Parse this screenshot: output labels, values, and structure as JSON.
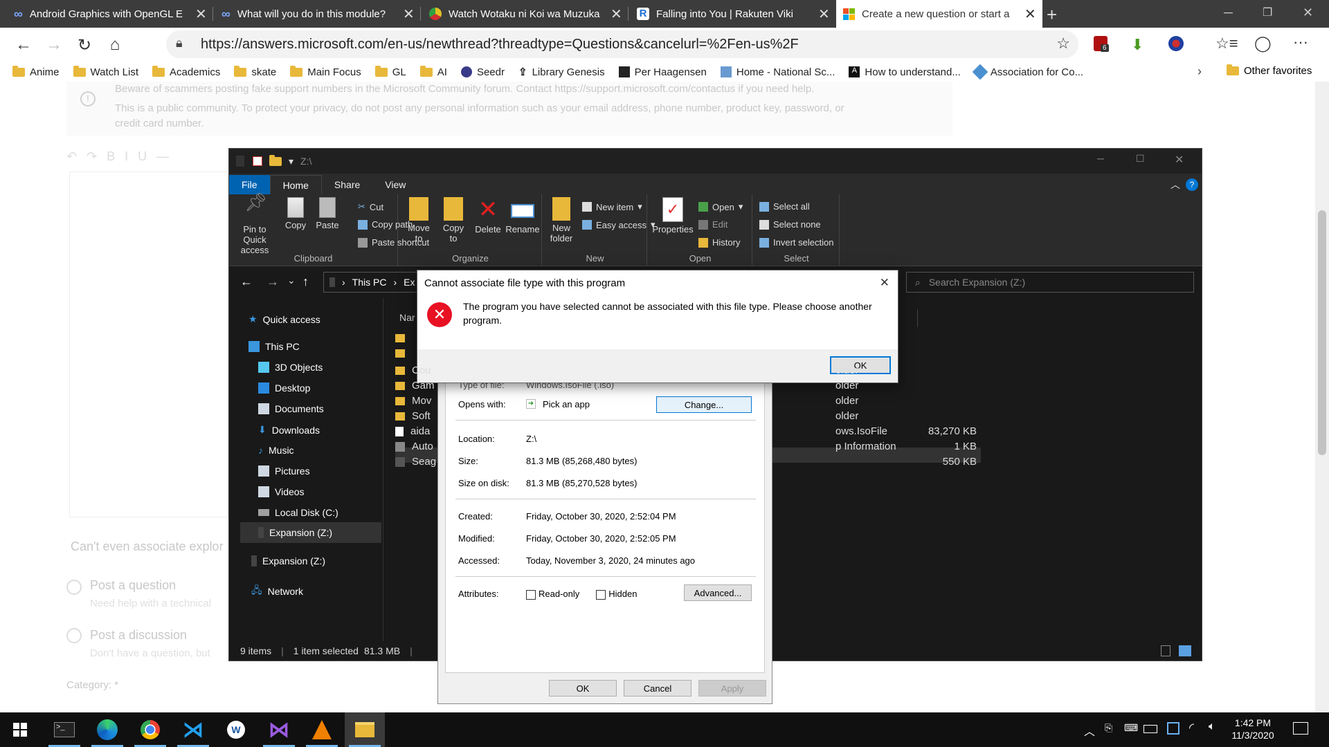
{
  "browser": {
    "tabs": [
      {
        "title": "Android Graphics with OpenGL E",
        "icon": "coursera-infinity-icon",
        "color": "#4a7bd6"
      },
      {
        "title": "What will you do in this module?",
        "icon": "coursera-infinity-icon",
        "color": "#4a7bd6"
      },
      {
        "title": "Watch Wotaku ni Koi wa Muzuka",
        "icon": "anime-site-icon",
        "color": "#e0c020"
      },
      {
        "title": "Falling into You | Rakuten Viki",
        "icon": "viki-icon",
        "color": "#1a6fd6"
      },
      {
        "title": "Create a new question or start a",
        "icon": "microsoft-logo-icon",
        "color": "#f25022"
      }
    ],
    "new_tab": "+",
    "url": "https://answers.microsoft.com/en-us/newthread?threadtype=Questions&cancelurl=%2Fen-us%2F",
    "extension_badge": "6",
    "favorites": [
      "Anime",
      "Watch List",
      "Academics",
      "skate",
      "Main Focus",
      "GL",
      "AI",
      "Seedr",
      "Library Genesis",
      "Per Haagensen",
      "Home - National Sc...",
      "How to understand...",
      "Association for Co..."
    ],
    "other_favorites": "Other favorites"
  },
  "page": {
    "warning_line1": "Beware of scammers posting fake support numbers in the Microsoft Community forum. Contact https://support.microsoft.com/contactus if you need help.",
    "warning_line2": "This is a public community. To protect your privacy, do not post any personal information such as your email address, phone number, product key, password, or",
    "warning_line3": "credit card number.",
    "body_text": "Can't even associate explor",
    "option1_title": "Post a question",
    "option1_sub": "Need help with a technical",
    "option2_title": "Post a discussion",
    "option2_sub": "Don't have a question, but",
    "category_label": "Category: *"
  },
  "explorer": {
    "title": "Z:\\",
    "ribbon_tabs": [
      "File",
      "Home",
      "Share",
      "View"
    ],
    "clipboard": {
      "pin": "Pin to Quick access",
      "copy": "Copy",
      "paste": "Paste",
      "cut": "Cut",
      "copy_path": "Copy path",
      "paste_shortcut": "Paste shortcut",
      "label": "Clipboard"
    },
    "organize": {
      "move_to": "Move to",
      "copy_to": "Copy to",
      "delete": "Delete",
      "rename": "Rename",
      "label": "Organize"
    },
    "new": {
      "new_folder": "New folder",
      "new_item": "New item",
      "easy_access": "Easy access",
      "label": "New"
    },
    "open": {
      "properties": "Properties",
      "open": "Open",
      "edit": "Edit",
      "history": "History",
      "label": "Open"
    },
    "select": {
      "select_all": "Select all",
      "select_none": "Select none",
      "invert": "Invert selection",
      "label": "Select"
    },
    "breadcrumb": [
      "This PC",
      "Ex"
    ],
    "search_placeholder": "Search Expansion (Z:)",
    "nav": [
      {
        "label": "Quick access",
        "icon": "star-icon",
        "color": "#3a96dd"
      },
      {
        "label": "This PC",
        "icon": "pc-icon",
        "color": "#3a96dd"
      },
      {
        "label": "3D Objects",
        "icon": "cube-icon",
        "color": "#56c8f0"
      },
      {
        "label": "Desktop",
        "icon": "desktop-icon",
        "color": "#2a8adf"
      },
      {
        "label": "Documents",
        "icon": "document-icon",
        "color": "#cfd8e2"
      },
      {
        "label": "Downloads",
        "icon": "download-icon",
        "color": "#3a96dd"
      },
      {
        "label": "Music",
        "icon": "music-icon",
        "color": "#3a96dd"
      },
      {
        "label": "Pictures",
        "icon": "picture-icon",
        "color": "#cfd8e2"
      },
      {
        "label": "Videos",
        "icon": "video-icon",
        "color": "#cfd8e2"
      },
      {
        "label": "Local Disk (C:)",
        "icon": "drive-icon",
        "color": "#a0a0a0"
      },
      {
        "label": "Expansion (Z:)",
        "icon": "drive-icon",
        "color": "#444"
      },
      {
        "label": "Expansion (Z:)",
        "icon": "drive-icon",
        "color": "#444"
      },
      {
        "label": "Network",
        "icon": "network-icon",
        "color": "#3a96dd"
      }
    ],
    "column_name": "Nar",
    "files": [
      {
        "name": "",
        "type": "",
        "size": "",
        "icon": "folder"
      },
      {
        "name": "",
        "type": "",
        "size": "",
        "icon": "folder"
      },
      {
        "name": "Cou",
        "type": "older",
        "size": "",
        "icon": "folder"
      },
      {
        "name": "Gam",
        "type": "older",
        "size": "",
        "icon": "folder"
      },
      {
        "name": "Mov",
        "type": "older",
        "size": "",
        "icon": "folder"
      },
      {
        "name": "Soft",
        "type": "older",
        "size": "",
        "icon": "folder"
      },
      {
        "name": "aida",
        "type": "ows.IsoFile",
        "size": "83,270 KB",
        "icon": "file"
      },
      {
        "name": "Auto",
        "type": "p Information",
        "size": "1 KB",
        "icon": "setup"
      },
      {
        "name": "Seag",
        "type": "",
        "size": "550 KB",
        "icon": "app"
      }
    ],
    "status": {
      "items": "9 items",
      "selected": "1 item selected",
      "size": "81.3 MB"
    }
  },
  "properties": {
    "type_of_file_label": "Type of file:",
    "type_of_file_value": "Windows.IsoFile (.iso)",
    "opens_with_label": "Opens with:",
    "opens_with_value": "Pick an app",
    "change_button": "Change...",
    "location_label": "Location:",
    "location_value": "Z:\\",
    "size_label": "Size:",
    "size_value": "81.3 MB (85,268,480 bytes)",
    "size_disk_label": "Size on disk:",
    "size_disk_value": "81.3 MB (85,270,528 bytes)",
    "created_label": "Created:",
    "created_value": "Friday, October 30, 2020, 2:52:04 PM",
    "modified_label": "Modified:",
    "modified_value": "Friday, October 30, 2020, 2:52:05 PM",
    "accessed_label": "Accessed:",
    "accessed_value": "Today, November 3, 2020, 24 minutes ago",
    "attributes_label": "Attributes:",
    "readonly": "Read-only",
    "hidden": "Hidden",
    "advanced": "Advanced...",
    "ok": "OK",
    "cancel": "Cancel",
    "apply": "Apply"
  },
  "error_dialog": {
    "title": "Cannot associate file type with this program",
    "message": "The program you have selected cannot be associated with this file type. Please choose another program.",
    "ok": "OK"
  },
  "taskbar": {
    "time": "1:42 PM",
    "date": "11/3/2020",
    "apps": [
      "start",
      "terminal",
      "edge",
      "chrome",
      "vscode",
      "writer",
      "visual-studio",
      "vlc",
      "file-explorer"
    ]
  }
}
